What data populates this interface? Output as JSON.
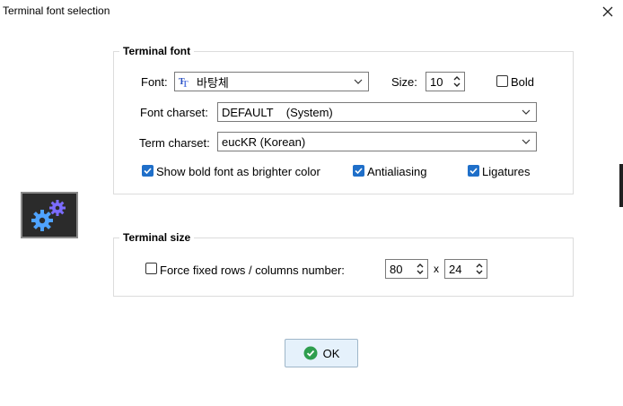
{
  "window": {
    "title": "Terminal font selection"
  },
  "terminal_font": {
    "group_title": "Terminal font",
    "font_label": "Font:",
    "font_value": "바탕체",
    "size_label": "Size:",
    "size_value": "10",
    "bold_label": "Bold",
    "bold_checked": false,
    "charset_label": "Font charset:",
    "charset_value": "DEFAULT    (System)",
    "term_charset_label": "Term charset:",
    "term_charset_value": "eucKR (Korean)",
    "bright_label": "Show bold font as brighter color",
    "bright_checked": true,
    "antialias_label": "Antialiasing",
    "antialias_checked": true,
    "ligatures_label": "Ligatures",
    "ligatures_checked": true
  },
  "terminal_size": {
    "group_title": "Terminal size",
    "force_label": "Force fixed rows / columns number:",
    "force_checked": false,
    "columns": "80",
    "separator": "x",
    "rows": "24"
  },
  "buttons": {
    "ok_label": "OK"
  },
  "colors": {
    "accent": "#1f6fc9",
    "ok_green": "#2e9e4e",
    "gear_blue": "#4fa3ff",
    "gear_purple": "#7b6cff"
  }
}
